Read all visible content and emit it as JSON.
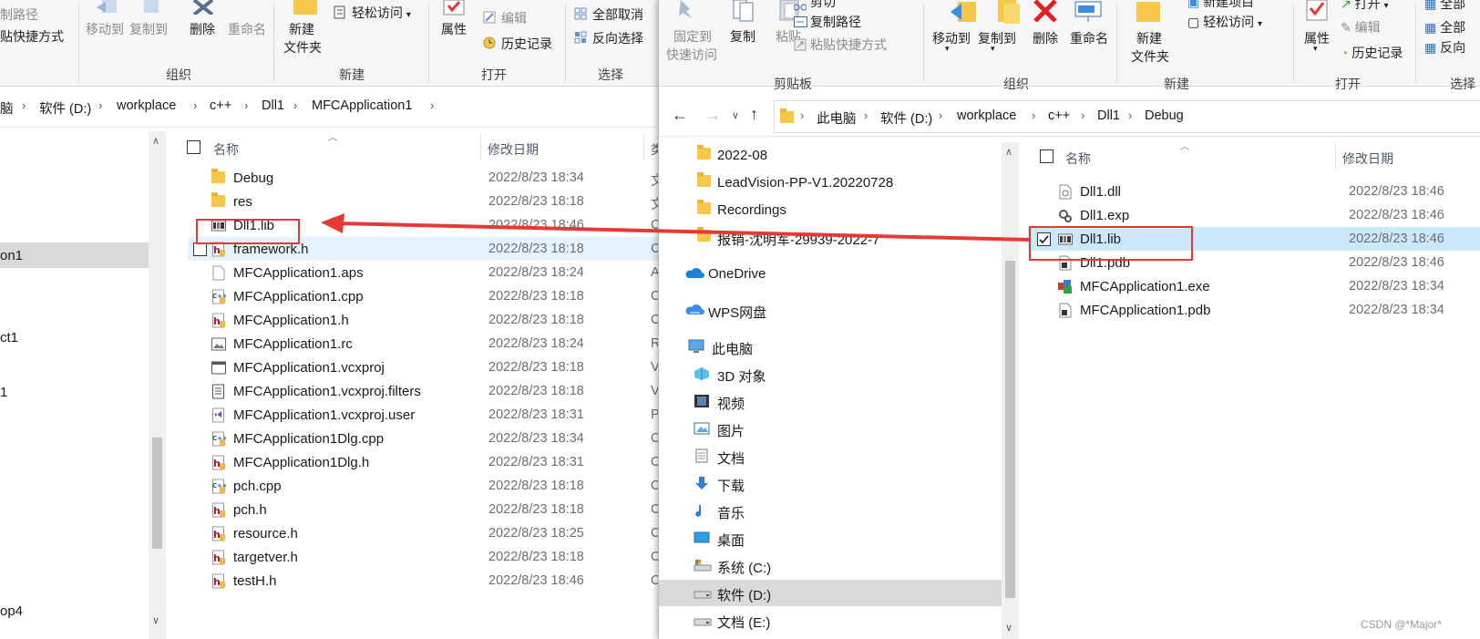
{
  "left": {
    "ribbon": {
      "copy_path": "制路径",
      "paste_shortcut": "贴快捷方式",
      "move_to": "移动到",
      "copy_to": "复制到",
      "delete": "删除",
      "rename": "重命名",
      "new_folder_line1": "新建",
      "new_folder_line2": "文件夹",
      "easy_access": "轻松访问",
      "properties": "属性",
      "edit": "编辑",
      "history": "历史记录",
      "select_all": "全部取消",
      "invert": "反向选择",
      "group_organize": "组织",
      "group_new": "新建",
      "group_open": "打开",
      "group_select": "选择"
    },
    "breadcrumb": [
      "脑",
      "软件 (D:)",
      "workplace",
      "c++",
      "Dll1",
      "MFCApplication1"
    ],
    "columns": {
      "name": "名称",
      "date": "修改日期",
      "type": "类"
    },
    "nav_fragments": [
      "on1",
      "ct1",
      "1",
      "op4"
    ],
    "files": [
      {
        "name": "Debug",
        "date": "2022/8/23 18:34",
        "type": "文",
        "icon": "folder-icon"
      },
      {
        "name": "res",
        "date": "2022/8/23 18:18",
        "type": "文",
        "icon": "folder-icon"
      },
      {
        "name": "Dll1.lib",
        "date": "2022/8/23 18:46",
        "type": "C",
        "icon": "lib-file-icon"
      },
      {
        "name": "framework.h",
        "date": "2022/8/23 18:18",
        "type": "C",
        "icon": "header-file-icon"
      },
      {
        "name": "MFCApplication1.aps",
        "date": "2022/8/23 18:24",
        "type": "A",
        "icon": "blank-file-icon"
      },
      {
        "name": "MFCApplication1.cpp",
        "date": "2022/8/23 18:18",
        "type": "C",
        "icon": "cpp-file-icon"
      },
      {
        "name": "MFCApplication1.h",
        "date": "2022/8/23 18:18",
        "type": "C",
        "icon": "header-file-icon"
      },
      {
        "name": "MFCApplication1.rc",
        "date": "2022/8/23 18:24",
        "type": "R",
        "icon": "rc-file-icon"
      },
      {
        "name": "MFCApplication1.vcxproj",
        "date": "2022/8/23 18:18",
        "type": "V",
        "icon": "vcxproj-file-icon"
      },
      {
        "name": "MFCApplication1.vcxproj.filters",
        "date": "2022/8/23 18:18",
        "type": "V",
        "icon": "filters-file-icon"
      },
      {
        "name": "MFCApplication1.vcxproj.user",
        "date": "2022/8/23 18:31",
        "type": "P",
        "icon": "vs-user-file-icon"
      },
      {
        "name": "MFCApplication1Dlg.cpp",
        "date": "2022/8/23 18:34",
        "type": "C",
        "icon": "cpp-file-icon"
      },
      {
        "name": "MFCApplication1Dlg.h",
        "date": "2022/8/23 18:31",
        "type": "C",
        "icon": "header-file-icon"
      },
      {
        "name": "pch.cpp",
        "date": "2022/8/23 18:18",
        "type": "C",
        "icon": "cpp-file-icon"
      },
      {
        "name": "pch.h",
        "date": "2022/8/23 18:18",
        "type": "C",
        "icon": "header-file-icon"
      },
      {
        "name": "resource.h",
        "date": "2022/8/23 18:25",
        "type": "C",
        "icon": "header-file-icon"
      },
      {
        "name": "targetver.h",
        "date": "2022/8/23 18:18",
        "type": "C",
        "icon": "header-file-icon"
      },
      {
        "name": "testH.h",
        "date": "2022/8/23 18:46",
        "type": "C",
        "icon": "header-file-icon"
      }
    ]
  },
  "right": {
    "ribbon": {
      "cut": "剪切",
      "pin_line1": "固定到",
      "pin_line2": "快速访问",
      "copy": "复制",
      "paste": "粘贴",
      "copy_path": "复制路径",
      "paste_shortcut": "粘贴快捷方式",
      "move_to": "移动到",
      "copy_to": "复制到",
      "delete": "删除",
      "rename": "重命名",
      "new_folder_line1": "新建",
      "new_folder_line2": "文件夹",
      "new_item": "新建项目",
      "easy_access": "轻松访问",
      "properties": "属性",
      "open": "打开",
      "edit": "编辑",
      "history": "历史记录",
      "select_all": "全部",
      "select_none": "全部",
      "invert": "反向",
      "group_clipboard": "剪贴板",
      "group_organize": "组织",
      "group_new": "新建",
      "group_open": "打开",
      "group_select": "选择"
    },
    "breadcrumb": [
      "此电脑",
      "软件 (D:)",
      "workplace",
      "c++",
      "Dll1",
      "Debug"
    ],
    "columns": {
      "name": "名称",
      "date": "修改日期"
    },
    "nav": [
      {
        "label": "2022-08",
        "icon": "folder-icon"
      },
      {
        "label": "LeadVision-PP-V1.20220728",
        "icon": "folder-icon"
      },
      {
        "label": "Recordings",
        "icon": "folder-icon"
      },
      {
        "label": "报销-沈明军-29939-2022-7",
        "icon": "folder-icon"
      },
      {
        "label": "OneDrive",
        "icon": "onedrive-icon"
      },
      {
        "label": "WPS网盘",
        "icon": "wps-cloud-icon"
      },
      {
        "label": "此电脑",
        "icon": "computer-icon"
      },
      {
        "label": "3D 对象",
        "icon": "3d-objects-icon"
      },
      {
        "label": "视频",
        "icon": "video-icon"
      },
      {
        "label": "图片",
        "icon": "pictures-icon"
      },
      {
        "label": "文档",
        "icon": "documents-icon"
      },
      {
        "label": "下载",
        "icon": "downloads-icon"
      },
      {
        "label": "音乐",
        "icon": "music-icon"
      },
      {
        "label": "桌面",
        "icon": "desktop-icon"
      },
      {
        "label": "系统 (C:)",
        "icon": "drive-c-icon"
      },
      {
        "label": "软件 (D:)",
        "icon": "drive-d-icon"
      },
      {
        "label": "文档 (E:)",
        "icon": "drive-e-icon"
      }
    ],
    "files": [
      {
        "name": "Dll1.dll",
        "date": "2022/8/23 18:46",
        "icon": "dll-file-icon"
      },
      {
        "name": "Dll1.exp",
        "date": "2022/8/23 18:46",
        "icon": "exp-file-icon"
      },
      {
        "name": "Dll1.lib",
        "date": "2022/8/23 18:46",
        "icon": "lib-file-icon"
      },
      {
        "name": "Dll1.pdb",
        "date": "2022/8/23 18:46",
        "icon": "pdb-file-icon"
      },
      {
        "name": "MFCApplication1.exe",
        "date": "2022/8/23 18:34",
        "icon": "exe-file-icon"
      },
      {
        "name": "MFCApplication1.pdb",
        "date": "2022/8/23 18:34",
        "icon": "pdb-file-icon"
      }
    ]
  },
  "watermark": "CSDN @*Major*",
  "colors": {
    "annotation_red": "#e53935",
    "selection": "#cce8ff",
    "hover": "#e5f3ff",
    "folder": "#f8c74a"
  }
}
